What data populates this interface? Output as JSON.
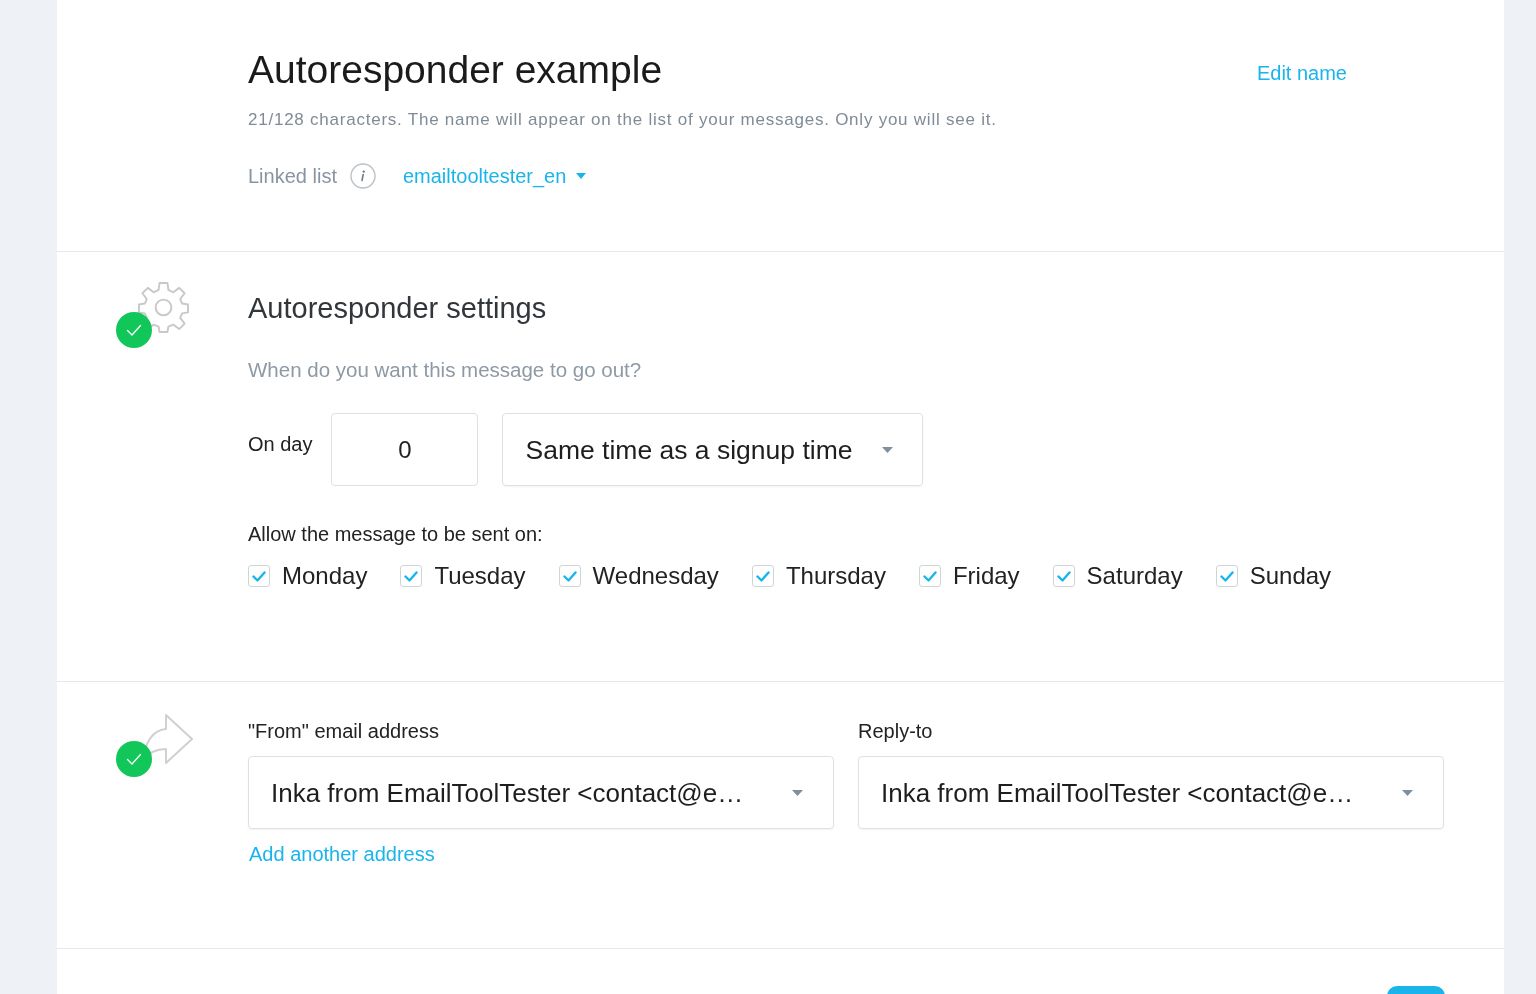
{
  "header": {
    "title": "Autoresponder example",
    "edit_link": "Edit name",
    "hint": "21/128 characters. The name will appear on the list of your messages. Only you will see it.",
    "linked_list": {
      "label": "Linked list",
      "value": "emailtooltester_en"
    }
  },
  "settings": {
    "complete": true,
    "title": "Autoresponder settings",
    "question": "When do you want this message to go out?",
    "day": {
      "label": "On day",
      "value": "0"
    },
    "time": {
      "value": "Same time as a signup time"
    },
    "days_label": "Allow the message to be sent on:",
    "days": [
      {
        "label": "Monday",
        "checked": true
      },
      {
        "label": "Tuesday",
        "checked": true
      },
      {
        "label": "Wednesday",
        "checked": true
      },
      {
        "label": "Thursday",
        "checked": true
      },
      {
        "label": "Friday",
        "checked": true
      },
      {
        "label": "Saturday",
        "checked": true
      },
      {
        "label": "Sunday",
        "checked": true
      }
    ]
  },
  "sender": {
    "complete": true,
    "from": {
      "label": "\"From\" email address",
      "value": "Inka from EmailToolTester <contact@e…"
    },
    "reply_to": {
      "label": "Reply-to",
      "value": "Inka from EmailToolTester <contact@e…"
    },
    "add_link": "Add another address"
  }
}
